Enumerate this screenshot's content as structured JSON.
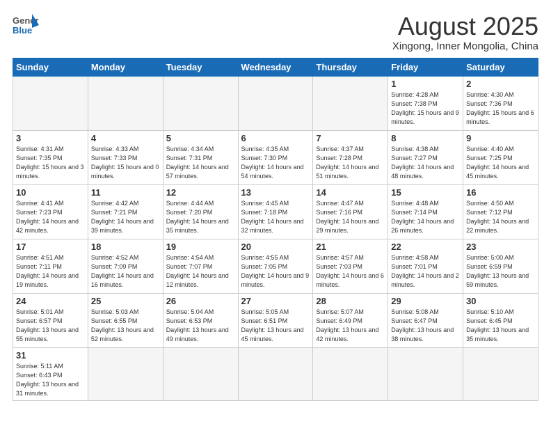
{
  "header": {
    "logo_general": "General",
    "logo_blue": "Blue",
    "month_title": "August 2025",
    "location": "Xingong, Inner Mongolia, China"
  },
  "weekdays": [
    "Sunday",
    "Monday",
    "Tuesday",
    "Wednesday",
    "Thursday",
    "Friday",
    "Saturday"
  ],
  "weeks": [
    [
      {
        "day": "",
        "info": ""
      },
      {
        "day": "",
        "info": ""
      },
      {
        "day": "",
        "info": ""
      },
      {
        "day": "",
        "info": ""
      },
      {
        "day": "",
        "info": ""
      },
      {
        "day": "1",
        "info": "Sunrise: 4:28 AM\nSunset: 7:38 PM\nDaylight: 15 hours\nand 9 minutes."
      },
      {
        "day": "2",
        "info": "Sunrise: 4:30 AM\nSunset: 7:36 PM\nDaylight: 15 hours\nand 6 minutes."
      }
    ],
    [
      {
        "day": "3",
        "info": "Sunrise: 4:31 AM\nSunset: 7:35 PM\nDaylight: 15 hours\nand 3 minutes."
      },
      {
        "day": "4",
        "info": "Sunrise: 4:33 AM\nSunset: 7:33 PM\nDaylight: 15 hours\nand 0 minutes."
      },
      {
        "day": "5",
        "info": "Sunrise: 4:34 AM\nSunset: 7:31 PM\nDaylight: 14 hours\nand 57 minutes."
      },
      {
        "day": "6",
        "info": "Sunrise: 4:35 AM\nSunset: 7:30 PM\nDaylight: 14 hours\nand 54 minutes."
      },
      {
        "day": "7",
        "info": "Sunrise: 4:37 AM\nSunset: 7:28 PM\nDaylight: 14 hours\nand 51 minutes."
      },
      {
        "day": "8",
        "info": "Sunrise: 4:38 AM\nSunset: 7:27 PM\nDaylight: 14 hours\nand 48 minutes."
      },
      {
        "day": "9",
        "info": "Sunrise: 4:40 AM\nSunset: 7:25 PM\nDaylight: 14 hours\nand 45 minutes."
      }
    ],
    [
      {
        "day": "10",
        "info": "Sunrise: 4:41 AM\nSunset: 7:23 PM\nDaylight: 14 hours\nand 42 minutes."
      },
      {
        "day": "11",
        "info": "Sunrise: 4:42 AM\nSunset: 7:21 PM\nDaylight: 14 hours\nand 39 minutes."
      },
      {
        "day": "12",
        "info": "Sunrise: 4:44 AM\nSunset: 7:20 PM\nDaylight: 14 hours\nand 35 minutes."
      },
      {
        "day": "13",
        "info": "Sunrise: 4:45 AM\nSunset: 7:18 PM\nDaylight: 14 hours\nand 32 minutes."
      },
      {
        "day": "14",
        "info": "Sunrise: 4:47 AM\nSunset: 7:16 PM\nDaylight: 14 hours\nand 29 minutes."
      },
      {
        "day": "15",
        "info": "Sunrise: 4:48 AM\nSunset: 7:14 PM\nDaylight: 14 hours\nand 26 minutes."
      },
      {
        "day": "16",
        "info": "Sunrise: 4:50 AM\nSunset: 7:12 PM\nDaylight: 14 hours\nand 22 minutes."
      }
    ],
    [
      {
        "day": "17",
        "info": "Sunrise: 4:51 AM\nSunset: 7:11 PM\nDaylight: 14 hours\nand 19 minutes."
      },
      {
        "day": "18",
        "info": "Sunrise: 4:52 AM\nSunset: 7:09 PM\nDaylight: 14 hours\nand 16 minutes."
      },
      {
        "day": "19",
        "info": "Sunrise: 4:54 AM\nSunset: 7:07 PM\nDaylight: 14 hours\nand 12 minutes."
      },
      {
        "day": "20",
        "info": "Sunrise: 4:55 AM\nSunset: 7:05 PM\nDaylight: 14 hours\nand 9 minutes."
      },
      {
        "day": "21",
        "info": "Sunrise: 4:57 AM\nSunset: 7:03 PM\nDaylight: 14 hours\nand 6 minutes."
      },
      {
        "day": "22",
        "info": "Sunrise: 4:58 AM\nSunset: 7:01 PM\nDaylight: 14 hours\nand 2 minutes."
      },
      {
        "day": "23",
        "info": "Sunrise: 5:00 AM\nSunset: 6:59 PM\nDaylight: 13 hours\nand 59 minutes."
      }
    ],
    [
      {
        "day": "24",
        "info": "Sunrise: 5:01 AM\nSunset: 6:57 PM\nDaylight: 13 hours\nand 55 minutes."
      },
      {
        "day": "25",
        "info": "Sunrise: 5:03 AM\nSunset: 6:55 PM\nDaylight: 13 hours\nand 52 minutes."
      },
      {
        "day": "26",
        "info": "Sunrise: 5:04 AM\nSunset: 6:53 PM\nDaylight: 13 hours\nand 49 minutes."
      },
      {
        "day": "27",
        "info": "Sunrise: 5:05 AM\nSunset: 6:51 PM\nDaylight: 13 hours\nand 45 minutes."
      },
      {
        "day": "28",
        "info": "Sunrise: 5:07 AM\nSunset: 6:49 PM\nDaylight: 13 hours\nand 42 minutes."
      },
      {
        "day": "29",
        "info": "Sunrise: 5:08 AM\nSunset: 6:47 PM\nDaylight: 13 hours\nand 38 minutes."
      },
      {
        "day": "30",
        "info": "Sunrise: 5:10 AM\nSunset: 6:45 PM\nDaylight: 13 hours\nand 35 minutes."
      }
    ],
    [
      {
        "day": "31",
        "info": "Sunrise: 5:11 AM\nSunset: 6:43 PM\nDaylight: 13 hours\nand 31 minutes."
      },
      {
        "day": "",
        "info": ""
      },
      {
        "day": "",
        "info": ""
      },
      {
        "day": "",
        "info": ""
      },
      {
        "day": "",
        "info": ""
      },
      {
        "day": "",
        "info": ""
      },
      {
        "day": "",
        "info": ""
      }
    ]
  ]
}
